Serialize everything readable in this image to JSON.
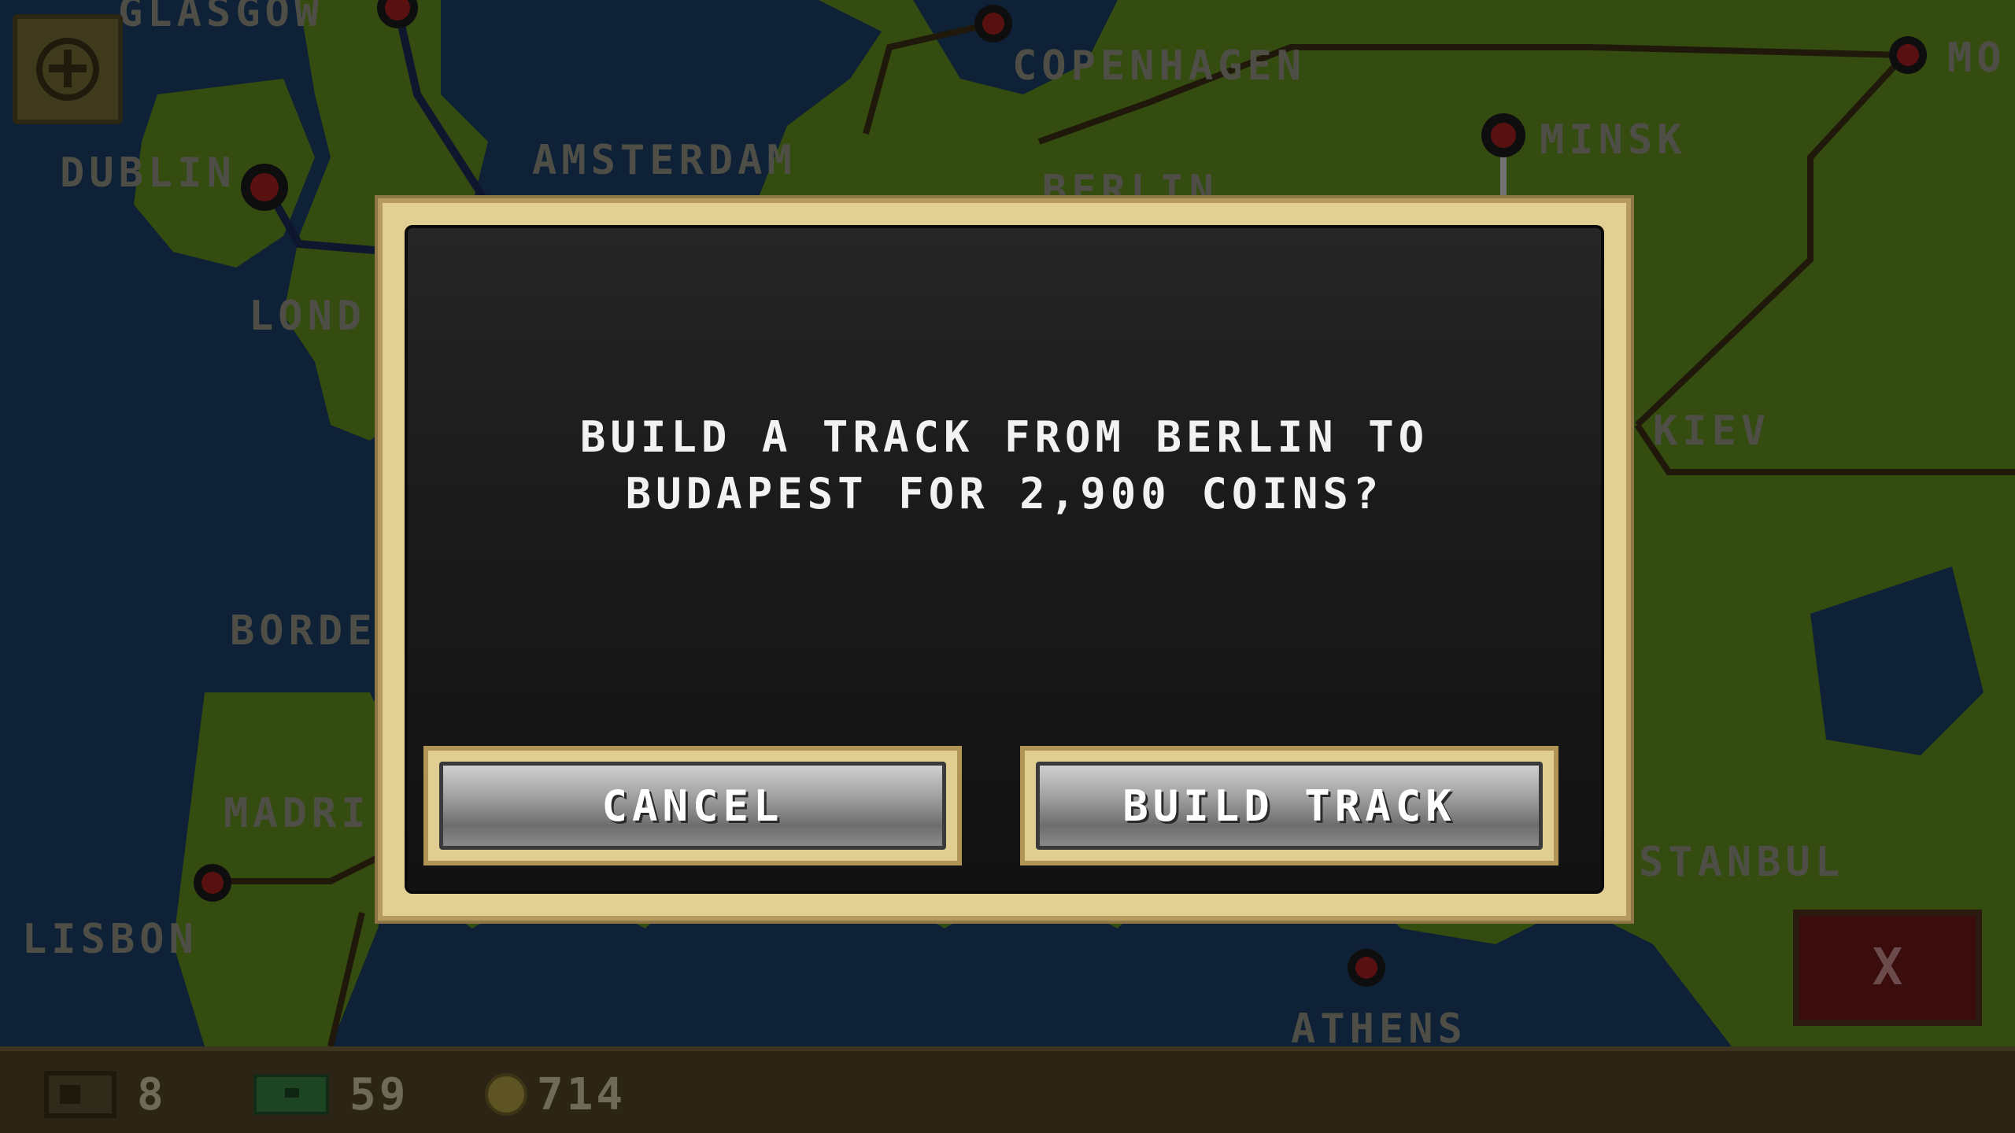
{
  "map": {
    "cities": [
      {
        "name": "GLASGOW"
      },
      {
        "name": "DUBLIN"
      },
      {
        "name": "AMSTERDAM"
      },
      {
        "name": "COPENHAGEN"
      },
      {
        "name": "MINSK"
      },
      {
        "name": "MO"
      },
      {
        "name": "BERLIN"
      },
      {
        "name": "LOND"
      },
      {
        "name": "KIEV"
      },
      {
        "name": "BORDE"
      },
      {
        "name": "MADRI"
      },
      {
        "name": "LISBON"
      },
      {
        "name": "STANBUL"
      },
      {
        "name": "ATHENS"
      }
    ]
  },
  "toolbar": {
    "zoom_icon": "plus-circle-icon",
    "close_icon": "x-icon",
    "close_label": "X",
    "close_color": "#3a0c0c"
  },
  "stats": {
    "trains": "8",
    "cash": "59",
    "coins": "714"
  },
  "dialog": {
    "message_line1": "BUILD A TRACK FROM BERLIN TO",
    "message_line2": "BUDAPEST FOR 2,900 COINS?",
    "cancel_label": "CANCEL",
    "confirm_label": "BUILD TRACK",
    "frame_color": "#e2cf93",
    "panel_color": "#1b1b1b"
  }
}
